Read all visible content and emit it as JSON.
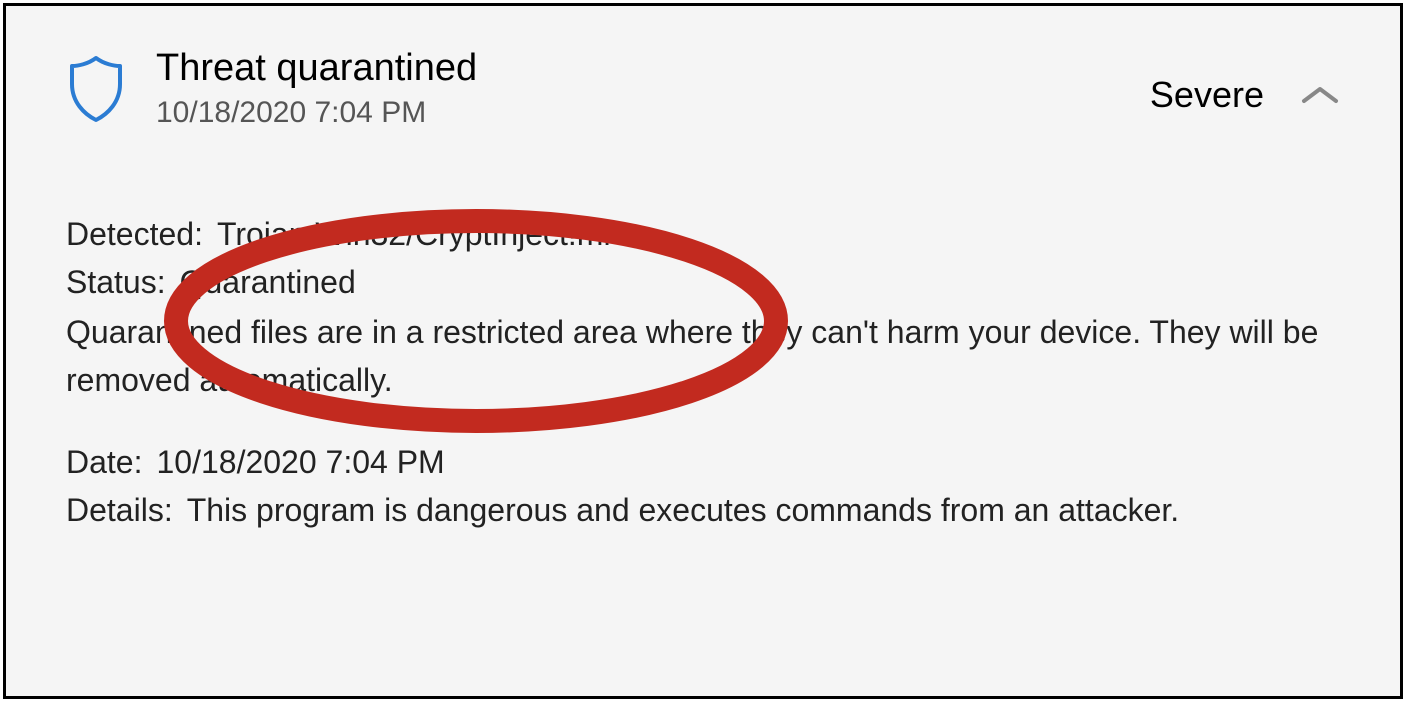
{
  "header": {
    "title": "Threat quarantined",
    "timestamp": "10/18/2020 7:04 PM",
    "severity": "Severe"
  },
  "detected": {
    "label": "Detected:",
    "value": "Trojan:Win32/CryptInject!ml"
  },
  "status": {
    "label": "Status:",
    "value": "Quarantined"
  },
  "description": "Quarantined files are in a restricted area where they can't harm your device. They will be removed automatically.",
  "date": {
    "label": "Date:",
    "value": "10/18/2020 7:04 PM"
  },
  "details": {
    "label": "Details:",
    "value": "This program is dangerous and executes commands from an attacker."
  }
}
